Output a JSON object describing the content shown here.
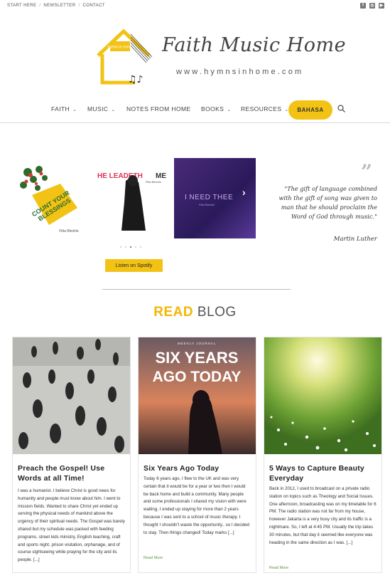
{
  "topbar": {
    "links": [
      "START HERE",
      "NEWSLETTER",
      "CONTACT"
    ],
    "social": [
      "facebook-icon",
      "instagram-icon",
      "youtube-icon"
    ]
  },
  "brand": {
    "logo_text": "hymns in home",
    "title": "Faith Music Home",
    "url": "www.hymnsinhome.com"
  },
  "nav": {
    "items": [
      {
        "label": "FAITH",
        "dropdown": true
      },
      {
        "label": "MUSIC",
        "dropdown": true
      },
      {
        "label": "NOTES FROM HOME",
        "dropdown": false
      },
      {
        "label": "BOOKS",
        "dropdown": true
      },
      {
        "label": "RESOURCES",
        "dropdown": true
      }
    ],
    "bahasa": "BAHASA"
  },
  "carousel": {
    "albums": [
      {
        "title": "COUNT YOUR BLESSINGS",
        "artist": "Fitta Bleshie"
      },
      {
        "title": "HE LEADETH ME",
        "artist": "Fitta Bleshie"
      },
      {
        "title": "I NEED THEE",
        "artist": "Fitta Bleshie"
      }
    ],
    "dots": 5,
    "active_dot": 3,
    "spotify_label": "Listen on Spotify"
  },
  "quote": {
    "text": "\"The gift of language combined with the gift of song was given to man that he should proclaim the Word of God through music.\"",
    "author": "Martin Luther"
  },
  "blog": {
    "heading_accent": "READ",
    "heading_rest": "BLOG",
    "posts": [
      {
        "title": "Preach the Gospel! Use Words at all Time!",
        "excerpt": "I was a humanist. I believe Christ is good news for humanity and people must know about him. I went to mission fields. Wanted to share Christ yet ended up serving the physical needs of mankind above the urgency of their spiritual needs. The Gospel was barely shared but my schedule was packed with feeding programs, street kids ministry, English teaching, craft and sports night, prison visitation, orphanage, and of course sightseeing while praying for the city and its people. [...]",
        "read_more": ""
      },
      {
        "title": "Six Years Ago Today",
        "image_kicker": "WEEKLY JOURNAL",
        "image_title": "SIX YEARS AGO TODAY",
        "excerpt": "Today 6 years ago, I flew to the UK and was very certain that it would be for a year or two then I would be back home and build a community. Many people and some professionals I shared my vision with were waiting. I ended up staying for more than 2 years because I was sent to a school of music therapy. I thought I shouldn't waste the opportunity.. so I decided to stay. Then things changed! Today marks [...]",
        "read_more": "Read More"
      },
      {
        "title": "5 Ways to Capture Beauty Everyday",
        "excerpt": "Back in 2012, I used to broadcast on a private radio station on topics such as Theology and Social Issues. One afternoon, broadcasting was on my timetable for 6 PM. The radio station was not far from my house, however Jakarta is a very busy city and its traffic is a nightmare. So, I left at 4:45 PM. Usually the trip takes 30 minutes, but that day it seemed like everyone was heading in the same direction as I was. [...]",
        "read_more": "Read More"
      }
    ]
  },
  "colors": {
    "accent": "#f2c315",
    "read_more": "#5a9a3a",
    "album3_bg": "#3a2270"
  }
}
